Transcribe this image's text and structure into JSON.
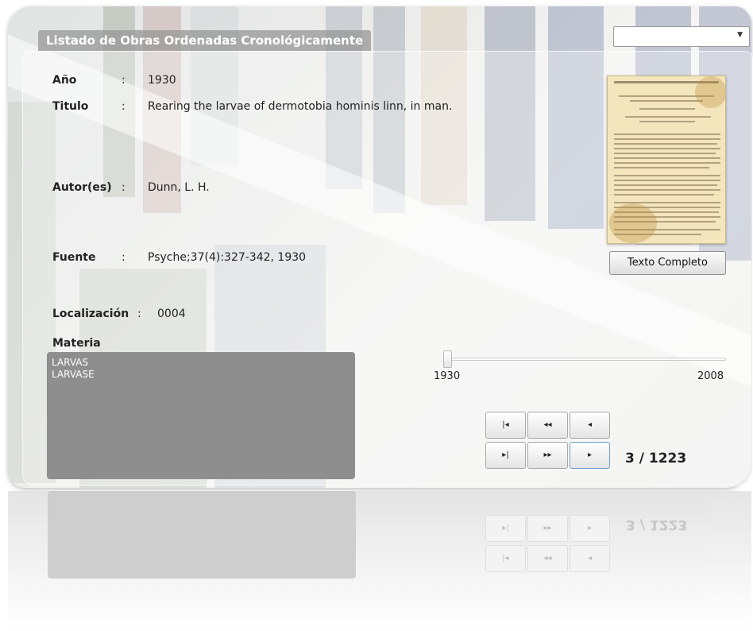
{
  "window": {
    "title": "Listado de Obras Ordenadas Cronológicamente",
    "combo_value": ""
  },
  "record": {
    "year_label": "Año",
    "year_value": "1930",
    "title_label": "Titulo",
    "title_value": "Rearing the larvae of dermotobia hominis linn, in man.",
    "author_label": "Autor(es)",
    "author_value": "Dunn, L. H.",
    "source_label": "Fuente",
    "source_value": "Psyche;37(4):327-342, 1930",
    "location_label": "Localización",
    "location_value": "0004",
    "separator": ":"
  },
  "materia": {
    "label": "Materia",
    "items": [
      "LARVAS",
      "LARVASE"
    ]
  },
  "full_text_button": "Texto Completo",
  "slider": {
    "min_label": "1930",
    "max_label": "2008",
    "min": 1930,
    "max": 2008,
    "value": 1930
  },
  "navigation": {
    "first": "|◂",
    "prev_page": "◂◂",
    "prev": "◂",
    "last": "▸|",
    "next_page": "▸▸",
    "next": "▸",
    "counter": "3 / 1223"
  },
  "colors": {
    "title_bar": "#969696",
    "materia_bg": "#8e8e8e",
    "thumbnail_paper": "#f3e6bd"
  }
}
